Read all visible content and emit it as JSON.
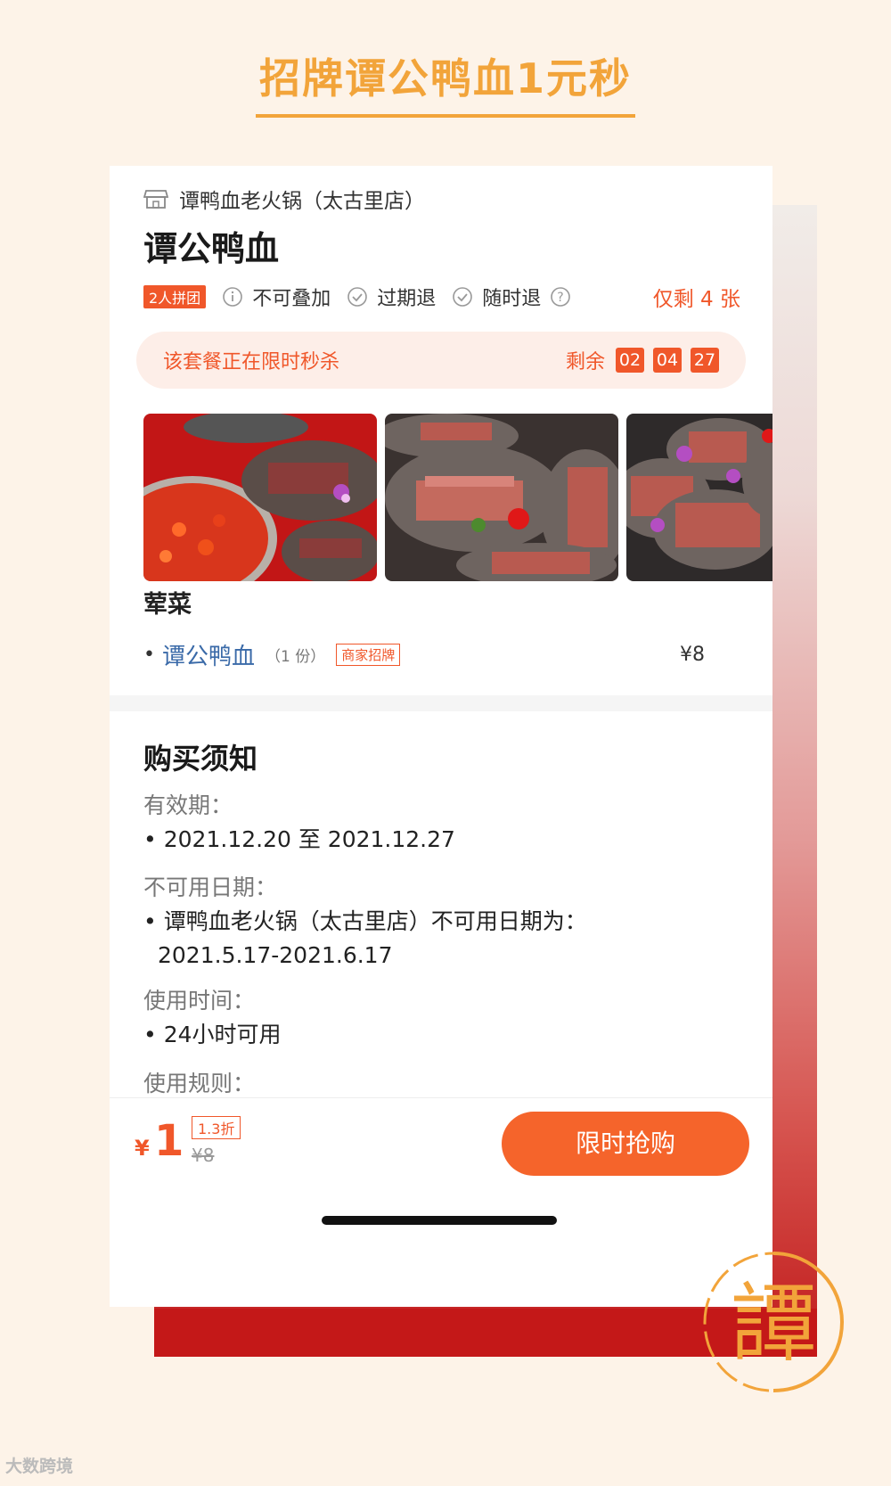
{
  "banner": {
    "title": "招牌谭公鸭血1元秒"
  },
  "store": {
    "name": "谭鸭血老火锅（太古里店）"
  },
  "deal": {
    "title": "谭公鸭血"
  },
  "tags": {
    "group": "2人拼团",
    "not_stackable": "不可叠加",
    "refund_expired": "过期退",
    "refund_anytime": "随时退",
    "stock": "仅剩 4 张"
  },
  "flash": {
    "text": "该套餐正在限时秒杀",
    "remain_label": "剩余",
    "timer": [
      "02",
      "04",
      "27"
    ]
  },
  "section_meat": "荤菜",
  "dish": {
    "name": "谭公鸭血",
    "qty": "（1 份）",
    "badge": "商家招牌",
    "price": "¥8"
  },
  "notice": {
    "title": "购买须知",
    "validity_label": "有效期：",
    "validity_value": "2021.12.20 至 2021.12.27",
    "unavailable_label": "不可用日期：",
    "unavailable_value_1": "谭鸭血老火锅（太古里店）不可用日期为：",
    "unavailable_value_2": "2021.5.17-2021.6.17",
    "usage_time_label": "使用时间：",
    "usage_time_value": "24小时可用",
    "rules_label": "使用规则："
  },
  "purchase": {
    "currency": "¥",
    "price": "1",
    "discount": "1.3折",
    "original_price": "¥8",
    "buy_label": "限时抢购"
  },
  "seal": {
    "char": "譚"
  },
  "watermark": "大数跨境",
  "colors": {
    "accent": "#f0572a",
    "banner": "#f2a43a",
    "panel_red": "#c41818"
  }
}
